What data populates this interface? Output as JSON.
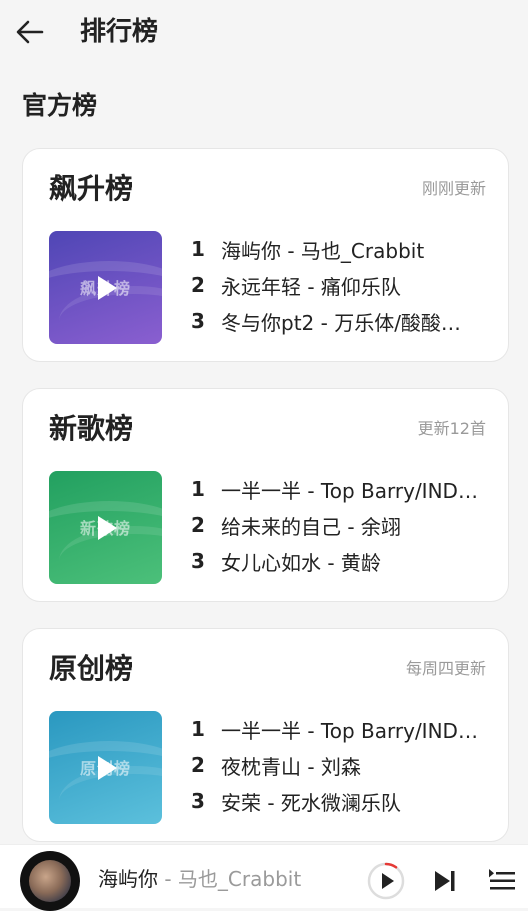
{
  "header": {
    "title": "排行榜",
    "back_icon": "arrow-left-icon"
  },
  "section": {
    "title": "官方榜"
  },
  "charts": [
    {
      "title": "飙升榜",
      "status": "刚刚更新",
      "cover_label": "飙升榜",
      "cover_colors": [
        "#4f46b5",
        "#8a5fd0"
      ],
      "tracks": [
        {
          "rank": "1",
          "text": "海屿你 - 马也_Crabbit"
        },
        {
          "rank": "2",
          "text": "永远年轻 - 痛仰乐队"
        },
        {
          "rank": "3",
          "text": "冬与你pt2 - 万乐体/酸酸…"
        }
      ]
    },
    {
      "title": "新歌榜",
      "status": "更新12首",
      "cover_label": "新歌榜",
      "cover_colors": [
        "#22a060",
        "#4cc07a"
      ],
      "tracks": [
        {
          "rank": "1",
          "text": "一半一半 - Top Barry/IND…"
        },
        {
          "rank": "2",
          "text": "给未来的自己 - 余翊"
        },
        {
          "rank": "3",
          "text": "女儿心如水 - 黄龄"
        }
      ]
    },
    {
      "title": "原创榜",
      "status": "每周四更新",
      "cover_label": "原创榜",
      "cover_colors": [
        "#2a98c0",
        "#5cc0dc"
      ],
      "tracks": [
        {
          "rank": "1",
          "text": "一半一半 - Top Barry/IND…"
        },
        {
          "rank": "2",
          "text": "夜枕青山 - 刘森"
        },
        {
          "rank": "3",
          "text": "安荣 - 死水微澜乐队"
        }
      ]
    }
  ],
  "player": {
    "title": "海屿你",
    "artist": " - 马也_Crabbit",
    "accent": "#e53935",
    "progress": 0.1,
    "icons": [
      "play-icon",
      "next-track-icon",
      "playlist-icon"
    ]
  }
}
